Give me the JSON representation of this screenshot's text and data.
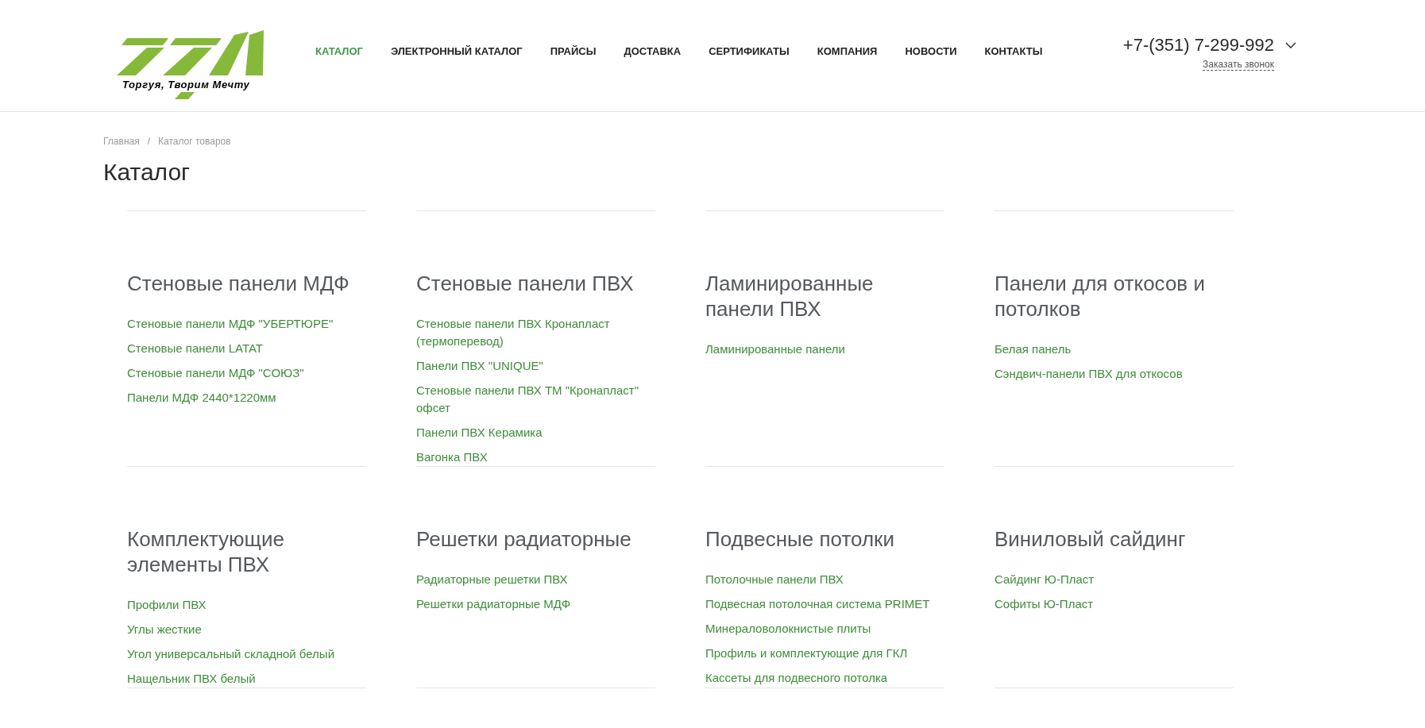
{
  "header": {
    "logo": {
      "slogan": "Торгуя, Творим Мечту"
    },
    "nav": [
      {
        "label": "КАТАЛОГ",
        "selected": true
      },
      {
        "label": "ЭЛЕКТРОННЫЙ КАТАЛОГ",
        "selected": false
      },
      {
        "label": "ПРАЙСЫ",
        "selected": false
      },
      {
        "label": "ДОСТАВКА",
        "selected": false
      },
      {
        "label": "СЕРТИФИКАТЫ",
        "selected": false
      },
      {
        "label": "КОМПАНИЯ",
        "selected": false
      },
      {
        "label": "НОВОСТИ",
        "selected": false
      },
      {
        "label": "КОНТАКТЫ",
        "selected": false
      }
    ],
    "phone": "+7-(351) 7-299-992",
    "callback_link": "Заказать звонок"
  },
  "breadcrumbs": {
    "items": [
      "Главная",
      "Каталог товаров"
    ],
    "separator": "/"
  },
  "title": "Каталог",
  "categories": [
    {
      "title": "Стеновые панели МДФ",
      "links": [
        "Стеновые панели МДФ \"УБЕРТЮРЕ\"",
        "Стеновые панели LATAT",
        "Стеновые панели МДФ \"СОЮЗ\"",
        "Панели МДФ 2440*1220мм"
      ]
    },
    {
      "title": "Стеновые панели ПВХ",
      "links": [
        "Стеновые панели ПВХ Кронапласт (термоперевод)",
        "Панели ПВХ \"UNIQUE\"",
        "Стеновые панели ПВХ ТМ \"Кронапласт\" офсет",
        "Панели ПВХ Керамика",
        "Вагонка ПВХ"
      ]
    },
    {
      "title": "Ламинированные панели ПВХ",
      "links": [
        "Ламинированные панели"
      ]
    },
    {
      "title": "Панели для откосов и потолков",
      "links": [
        "Белая панель",
        "Сэндвич-панели ПВХ для откосов"
      ]
    },
    {
      "title": "Комплектующие элементы ПВХ",
      "links": [
        "Профили ПВХ",
        "Углы жесткие",
        "Угол универсальный складной белый",
        "Нащельник ПВХ белый"
      ]
    },
    {
      "title": "Решетки радиаторные",
      "links": [
        "Радиаторные решетки ПВХ",
        "Решетки радиаторные МДФ"
      ]
    },
    {
      "title": "Подвесные потолки",
      "links": [
        "Потолочные панели ПВХ",
        "Подвесная потолочная система PRIMET",
        "Минераловолокнистые плиты",
        "Профиль и комплектующие для ГКЛ",
        "Кассеты для подвесного потолка"
      ]
    },
    {
      "title": "Виниловый сайдинг",
      "links": [
        "Сайдинг Ю-Пласт",
        "Софиты Ю-Пласт"
      ]
    }
  ]
}
